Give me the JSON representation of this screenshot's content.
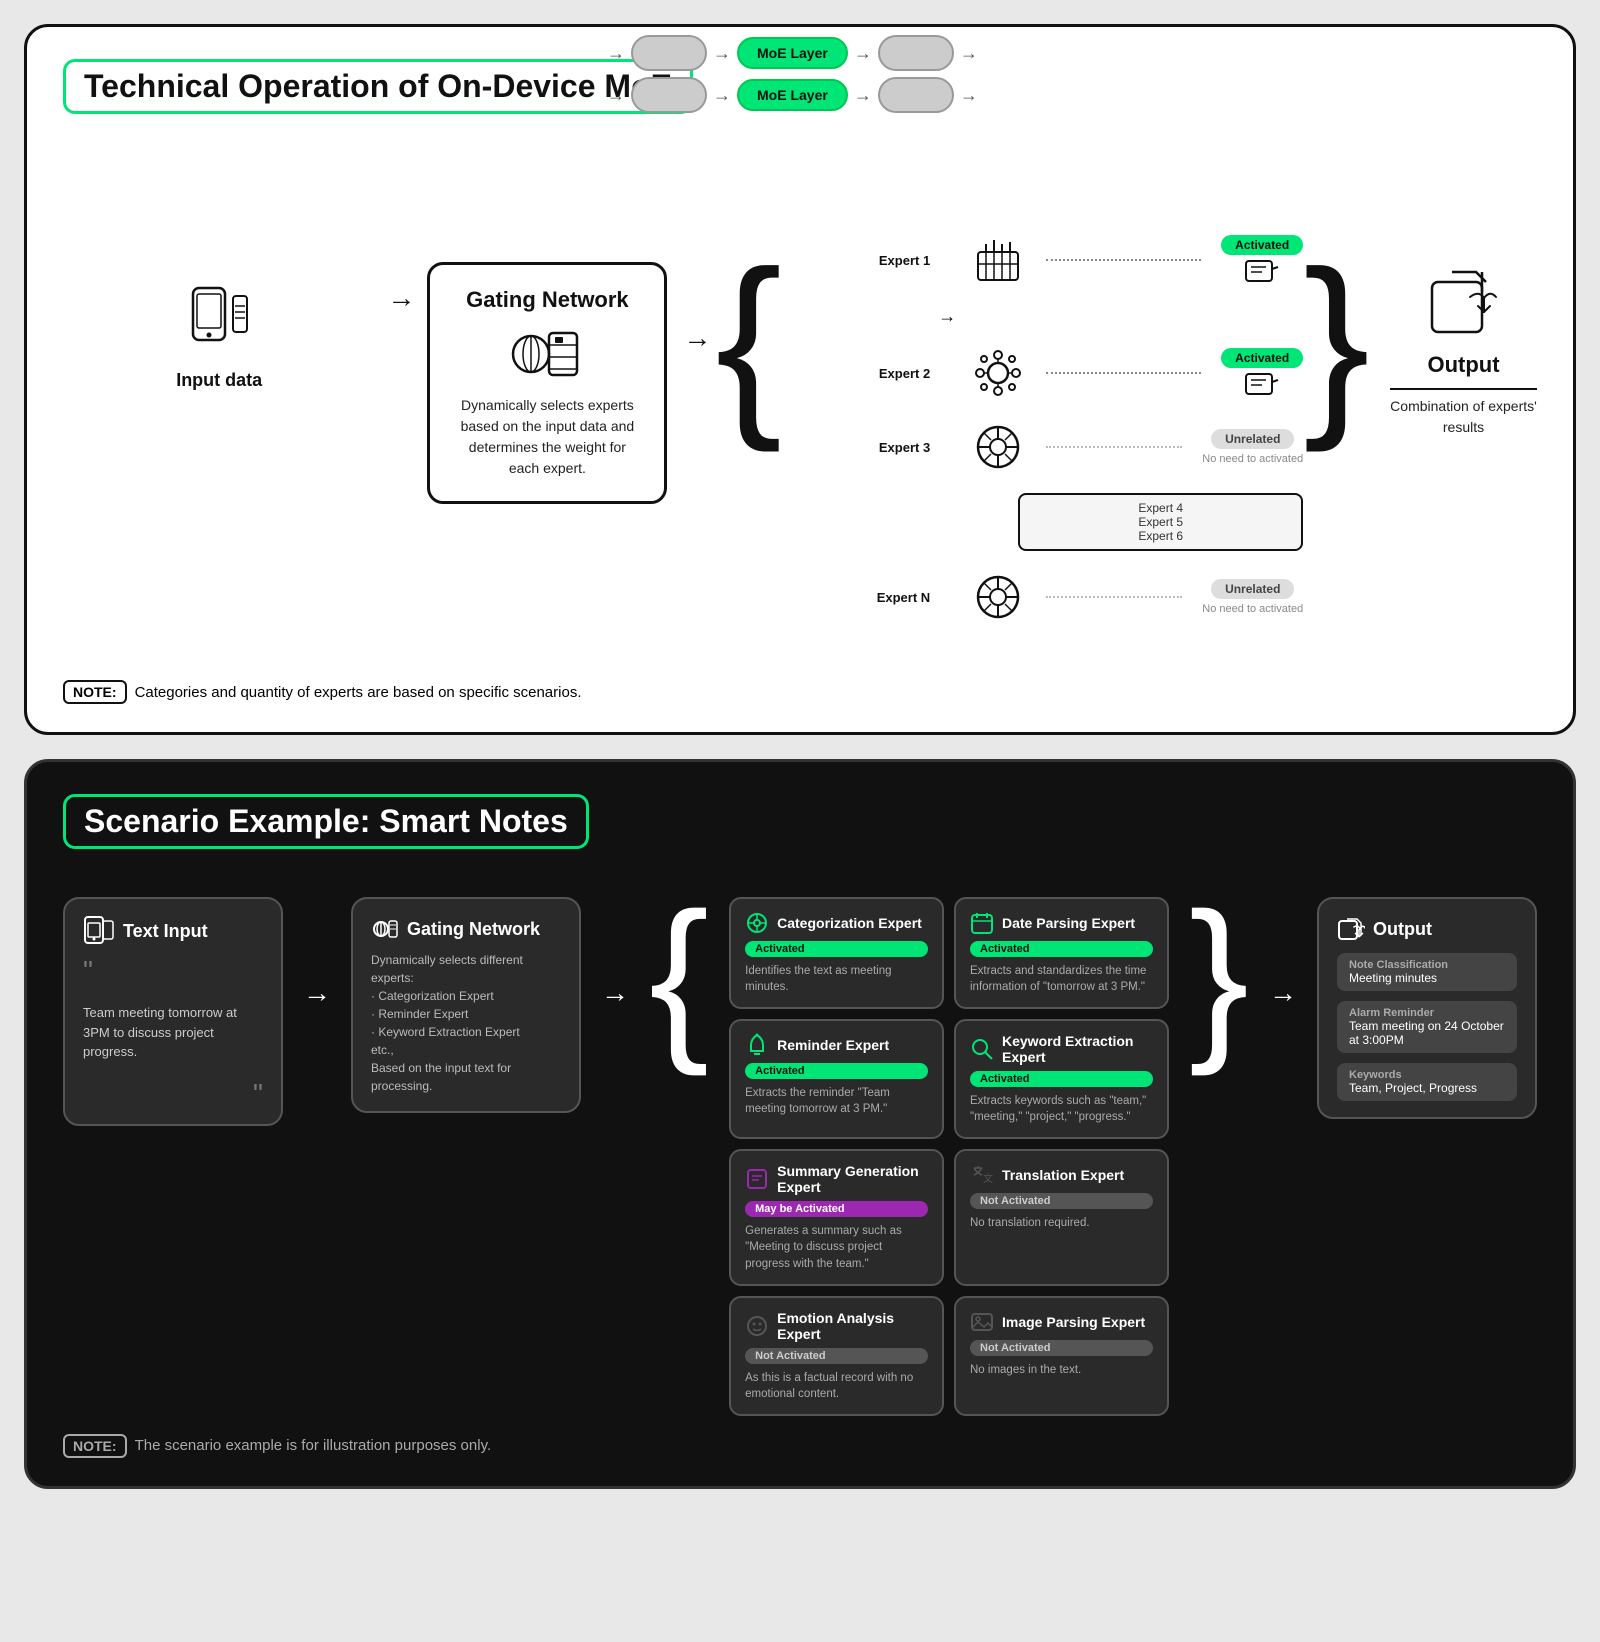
{
  "top_panel": {
    "title": "Technical Operation of On-Device MoE",
    "moe_layers": [
      {
        "label": "MoE Layer"
      },
      {
        "label": "MoE Layer"
      }
    ],
    "input_label": "Input data",
    "gating_network": {
      "title": "Gating Network",
      "description": "Dynamically selects experts based on the input data and determines the weight for each expert."
    },
    "experts": [
      {
        "label": "Expert 1",
        "status": "Activated",
        "type": "activated"
      },
      {
        "label": "Expert 2",
        "status": "Activated",
        "type": "activated"
      },
      {
        "label": "Expert 3",
        "status": "Unrelated",
        "type": "unrelated",
        "note": "No need to activated"
      },
      {
        "label": "",
        "extra": "Expert 4\nExpert 5\nExpert 6",
        "type": "extra"
      },
      {
        "label": "Expert N",
        "status": "Unrelated",
        "type": "unrelated",
        "note": "No need to activated"
      }
    ],
    "output": {
      "label": "Output",
      "description": "Combination of experts' results"
    },
    "note": "Categories and quantity of experts are based on specific scenarios."
  },
  "bottom_panel": {
    "title": "Scenario Example: Smart Notes",
    "text_input": {
      "title": "Text Input",
      "quote": "Team meeting tomorrow at 3PM to discuss project progress."
    },
    "gating_network": {
      "title": "Gating Network",
      "description": "Dynamically selects different experts:\n· Categorization Expert\n· Reminder Expert\n· Keyword Extraction Expert\netc.,\nBased on the input text for processing."
    },
    "experts": [
      {
        "title": "Categorization Expert",
        "status": "Activated",
        "status_type": "activated",
        "description": "Identifies the text as meeting minutes."
      },
      {
        "title": "Date Parsing Expert",
        "status": "Activated",
        "status_type": "activated",
        "description": "Extracts and standardizes the time information of \"tomorrow at 3 PM.\""
      },
      {
        "title": "Reminder Expert",
        "status": "Activated",
        "status_type": "activated",
        "description": "Extracts the reminder \"Team meeting tomorrow at 3 PM.\""
      },
      {
        "title": "Keyword Extraction Expert",
        "status": "Activated",
        "status_type": "activated",
        "description": "Extracts keywords such as \"team,\" \"meeting,\" \"project,\" \"progress.\""
      },
      {
        "title": "Summary Generation Expert",
        "status": "May be Activated",
        "status_type": "may",
        "description": "Generates a summary such as \"Meeting to discuss project progress with the team.\""
      },
      {
        "title": "Translation Expert",
        "status": "Not Activated",
        "status_type": "not",
        "description": "No translation required."
      },
      {
        "title": "Emotion Analysis Expert",
        "status": "Not Activated",
        "status_type": "not",
        "description": "As this is a factual record with no emotional content."
      },
      {
        "title": "Image Parsing Expert",
        "status": "Not Activated",
        "status_type": "not",
        "description": "No images in the text."
      }
    ],
    "output": {
      "title": "Output",
      "sections": [
        {
          "label": "Note Classification",
          "value": "Meeting minutes"
        },
        {
          "label": "Alarm Reminder",
          "value": "Team meeting on 24 October at 3:00PM"
        },
        {
          "label": "Keywords",
          "value": "Team, Project, Progress"
        }
      ]
    },
    "note": "The scenario example is for illustration purposes only."
  }
}
